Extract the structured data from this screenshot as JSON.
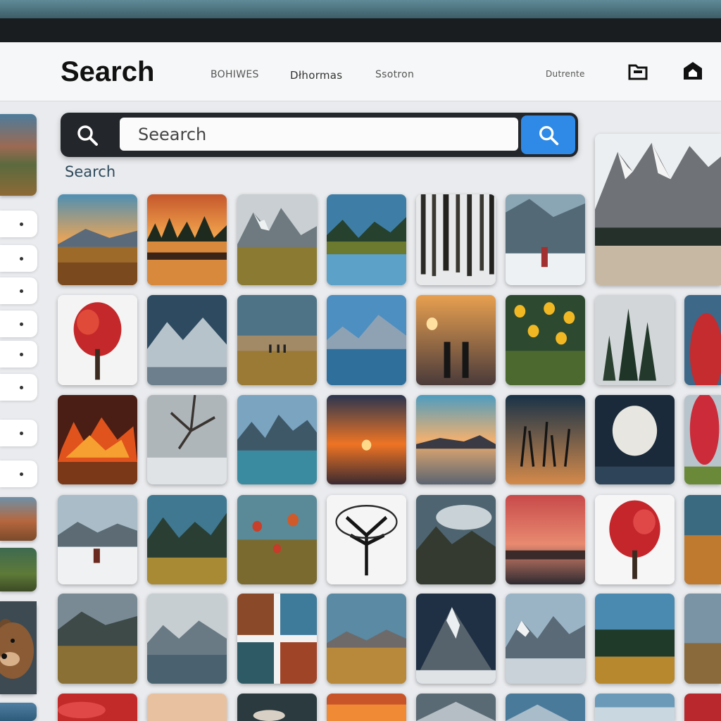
{
  "header": {
    "title": "Search",
    "nav": [
      "BOHIWES",
      "Dłhormas",
      "Ssotron",
      "Dutrente"
    ]
  },
  "search": {
    "value": "Seearch",
    "placeholder": "Seearch",
    "caption": "Search"
  },
  "icons": {
    "search": "search-icon",
    "submit": "search-icon",
    "header_left": "folder-upload-icon",
    "header_right": "home-icon"
  },
  "colors": {
    "accent": "#2e8ae6",
    "search_bar": "#23262a",
    "header_bg": "#f6f7f8"
  }
}
